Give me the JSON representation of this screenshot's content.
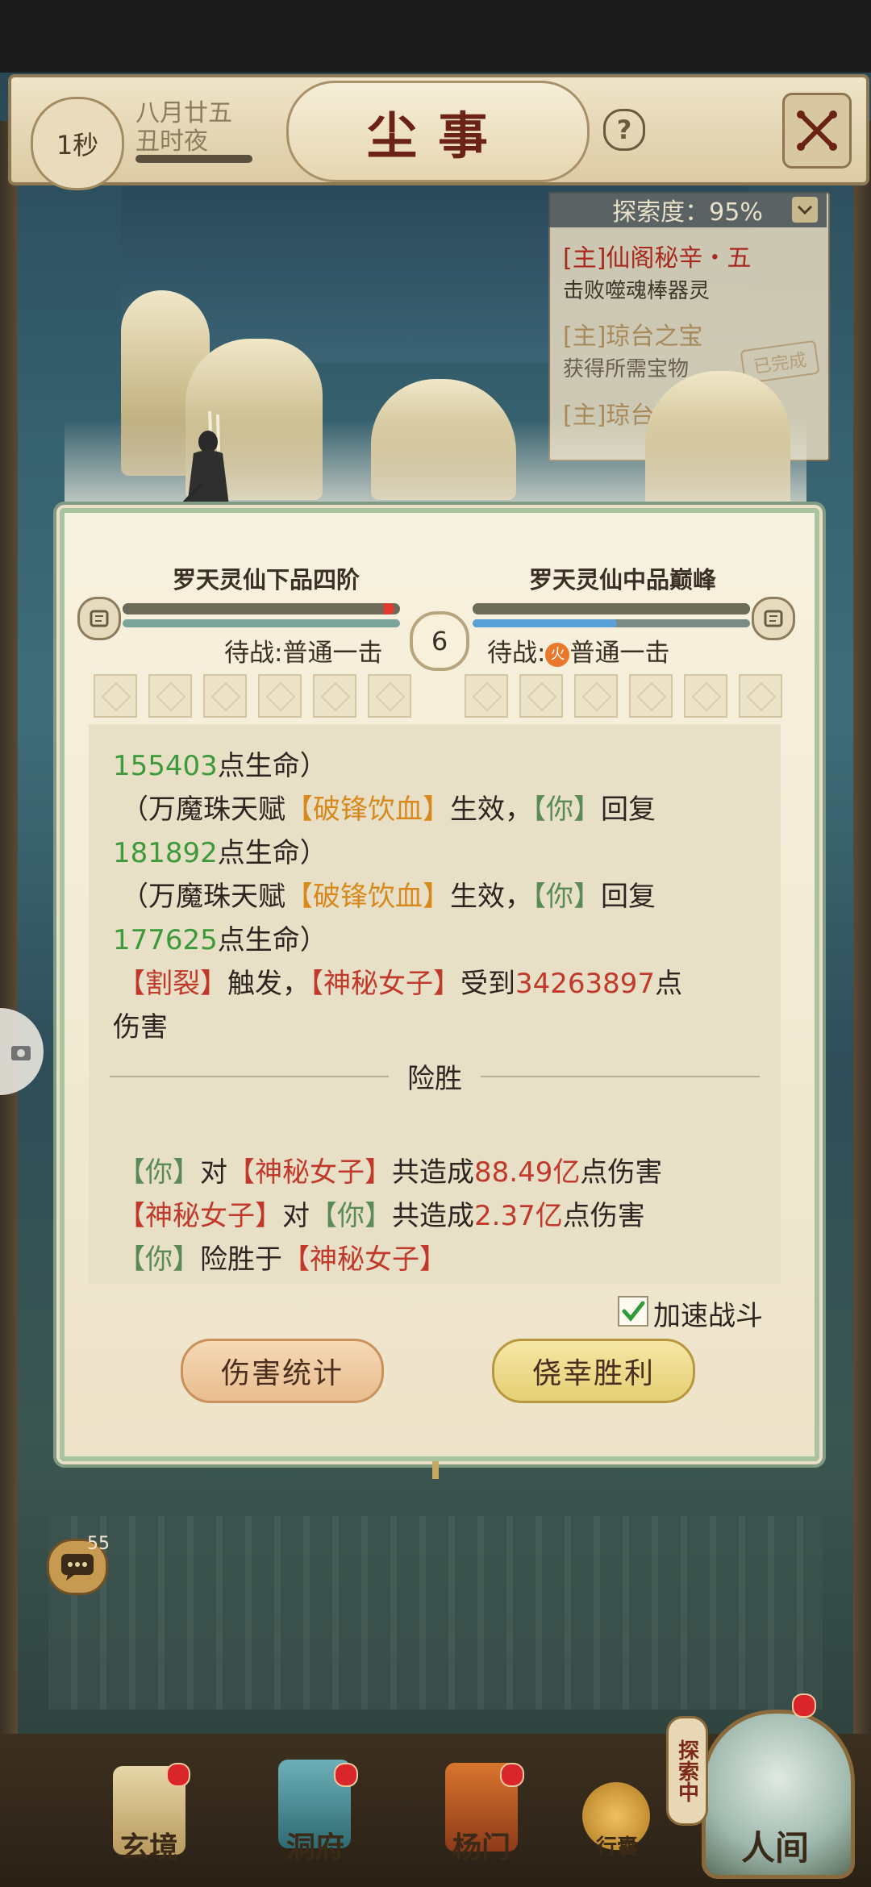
{
  "header": {
    "timer": "1秒",
    "date_line1": "八月廿五",
    "date_line2": "丑时夜",
    "title": "尘事",
    "help_label": "?"
  },
  "quests": {
    "progress": "探索度：95%",
    "items": [
      {
        "title": "[主]仙阁秘辛・五",
        "subtitle": "击败噬魂棒器灵"
      },
      {
        "title": "[主]琼台之宝",
        "subtitle": "获得所需宝物",
        "stamp": "已完成"
      },
      {
        "title": "[主]琼台"
      }
    ]
  },
  "battle": {
    "left_level": "罗天灵仙下品四阶",
    "right_level": "罗天灵仙中品巅峰",
    "left_hp_fraction": 0.98,
    "right_hp_fraction": 1.0,
    "right_mp_fraction": 0.52,
    "round": "6",
    "left_status_prefix": "待战:",
    "left_status_action": "普通一击",
    "right_status_prefix": "待战:",
    "right_status_element": "火",
    "right_status_action": "普通一击"
  },
  "log": {
    "l1_num": "155403",
    "l1_text": "点生命）",
    "l2_a": "（万魔珠天赋",
    "l2_skill": "【破锋饮血】",
    "l2_b": "生效，",
    "l2_you": "【你】",
    "l2_c": "回复",
    "l3_num": "181892",
    "l3_text": "点生命）",
    "l4_a": "（万魔珠天赋",
    "l4_skill": "【破锋饮血】",
    "l4_b": "生效，",
    "l4_you": "【你】",
    "l4_c": "回复",
    "l5_num": "177625",
    "l5_text": "点生命）",
    "l6_skill": "【割裂】",
    "l6_a": "触发，",
    "l6_enemy": "【神秘女子】",
    "l6_b": "受到",
    "l6_num": "34263897",
    "l6_c": "点",
    "l7_text": "伤害",
    "result": "险胜",
    "s1_you": "【你】",
    "s1_a": "对",
    "s1_enemy": "【神秘女子】",
    "s1_b": "共造成",
    "s1_num": "88.49亿",
    "s1_c": "点伤害",
    "s2_enemy": "【神秘女子】",
    "s2_a": "对",
    "s2_you": "【你】",
    "s2_b": "共造成",
    "s2_num": "2.37亿",
    "s2_c": "点伤害",
    "s3_you": "【你】",
    "s3_a": "险胜于",
    "s3_enemy": "【神秘女子】"
  },
  "controls": {
    "speed_label": "加速战斗",
    "speed_checked": true,
    "damage_stats_button": "伤害统计",
    "lucky_win_button": "侥幸胜利"
  },
  "chat": {
    "count": "55"
  },
  "nav": {
    "items": [
      "玄境",
      "洞府",
      "杨门",
      "行囊"
    ],
    "world": "人间",
    "explore_tag": "探索中"
  },
  "colors": {
    "heal_green": "#3c9a3a",
    "skill_orange": "#d7891c",
    "enemy_red": "#c0392b",
    "title_red": "#6b2316"
  }
}
